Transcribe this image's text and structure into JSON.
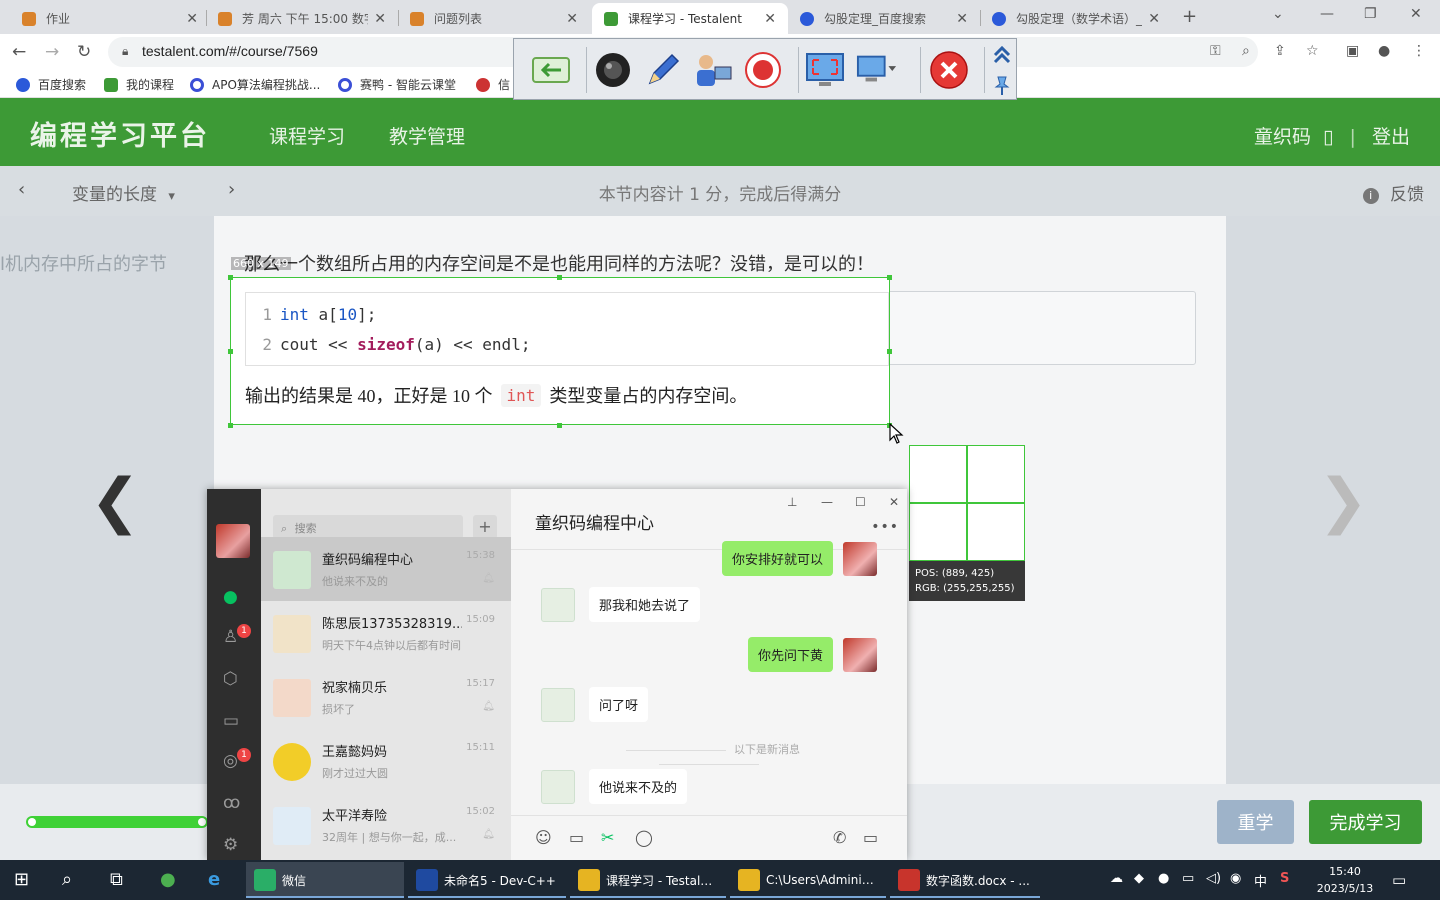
{
  "browser": {
    "tabs": [
      {
        "label": "作业",
        "color": "#d9822b"
      },
      {
        "label": "芳 周六 下午 15:00 数字",
        "color": "#d9822b"
      },
      {
        "label": "问题列表",
        "color": "#d9822b"
      },
      {
        "label": "课程学习 - Testalent",
        "color": "#3d9a36",
        "active": true
      },
      {
        "label": "勾股定理_百度搜索",
        "color": "#2b59d9"
      },
      {
        "label": "勾股定理（数学术语）_",
        "color": "#2b59d9"
      }
    ],
    "url": "testalent.com/#/course/7569",
    "bookmarks": [
      "百度搜索",
      "我的课程",
      "APO算法编程挑战...",
      "赛鸭 - 智能云课堂",
      "信"
    ]
  },
  "site": {
    "logo": "编程学习平台",
    "nav": [
      "课程学习",
      "教学管理"
    ],
    "user": "童织码",
    "user_icon": "▯",
    "separator": "|",
    "logout": "登出"
  },
  "lesson": {
    "title": "变量的长度",
    "dropdown_icon": "▾",
    "summary": "本节内容计 1 分，完成后得满分",
    "feedback": "反馈",
    "prev_page_text": "l机内存中所占的字节"
  },
  "content": {
    "intro": "那么一个数组所占用的内存空间是不是也能用同样的方法呢？没错，是可以的！",
    "code_lines": [
      {
        "n": "1",
        "parts": [
          {
            "t": "int",
            "c": "kw"
          },
          {
            "t": " a[",
            "c": ""
          },
          {
            "t": "10",
            "c": "num"
          },
          {
            "t": "];",
            "c": ""
          }
        ]
      },
      {
        "n": "2",
        "parts": [
          {
            "t": "cout << ",
            "c": ""
          },
          {
            "t": "sizeof",
            "c": "fn"
          },
          {
            "t": "(a) << endl;",
            "c": ""
          }
        ]
      }
    ],
    "result_pre": "输出的结果是 40，正好是 10 个",
    "result_code": "int",
    "result_post": "类型变量占的内存空间。"
  },
  "capture": {
    "size_label": "660 x 149",
    "pos_label": "POS:",
    "pos_value": "(889, 425)",
    "rgb_label": "RGB:",
    "rgb_value": "(255,255,255)"
  },
  "bottom": {
    "progress": 1.0,
    "relearn": "重学",
    "finish": "完成学习"
  },
  "wechat": {
    "search_placeholder": "搜索",
    "chat_title": "童织码编程中心",
    "conversations": [
      {
        "name": "童织码编程中心",
        "time": "15:38",
        "msg": "他说来不及的",
        "muted": true,
        "selected": true
      },
      {
        "name": "陈思辰13735328319...",
        "time": "15:09",
        "msg": "明天下午4点钟以后都有时间",
        "muted": false
      },
      {
        "name": "祝家楠贝乐",
        "time": "15:17",
        "msg": "损坏了",
        "muted": true
      },
      {
        "name": "王嘉懿妈妈",
        "time": "15:11",
        "msg": "刚才过过大圆",
        "muted": false
      },
      {
        "name": "太平洋寿险",
        "time": "15:02",
        "msg": "32周年 | 想与你一起，成...",
        "muted": true
      }
    ],
    "messages": [
      {
        "dir": "out",
        "text": "你安排好就可以"
      },
      {
        "dir": "in",
        "text": "那我和她去说了"
      },
      {
        "dir": "out",
        "text": "你先问下黄"
      },
      {
        "dir": "in",
        "text": "问了呀"
      },
      {
        "dir": "in",
        "text": "他说来不及的"
      }
    ],
    "new_messages_divider": "以下是新消息",
    "rail_badges": [
      "1",
      "1"
    ]
  },
  "taskbar": {
    "apps": [
      {
        "label": "微信",
        "color": "#2aae67",
        "active": true
      },
      {
        "label": "未命名5 - Dev-C++",
        "color": "#1f4aa0"
      },
      {
        "label": "课程学习 - Testale...",
        "color": "#e6b422"
      },
      {
        "label": "C:\\Users\\Adminis...",
        "color": "#e6b422"
      },
      {
        "label": "数字函数.docx - ...",
        "color": "#c8342c"
      }
    ],
    "ime": "中",
    "time": "15:40",
    "date": "2023/5/13"
  }
}
